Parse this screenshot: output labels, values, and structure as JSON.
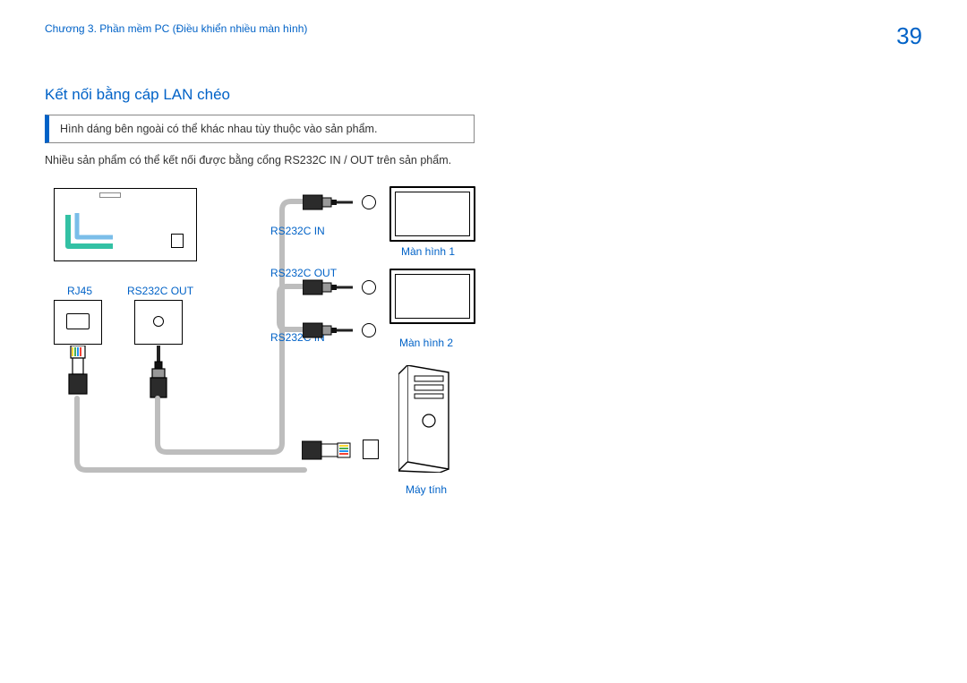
{
  "header": {
    "chapter": "Chương 3. Phần mềm PC (Điều khiển nhiều màn hình)",
    "page_number": "39"
  },
  "section": {
    "title": "Kết nối bằng cáp LAN chéo",
    "note": "Hình dáng bên ngoài có thể khác nhau tùy thuộc vào sản phẩm.",
    "description": "Nhiều sản phẩm có thể kết nối được bằng cổng RS232C IN / OUT trên sản phẩm."
  },
  "labels": {
    "rj45": "RJ45",
    "rs232c_out": "RS232C OUT",
    "rs232c_in": "RS232C IN",
    "monitor1": "Màn hình 1",
    "monitor2": "Màn hình 2",
    "computer": "Máy tính"
  }
}
